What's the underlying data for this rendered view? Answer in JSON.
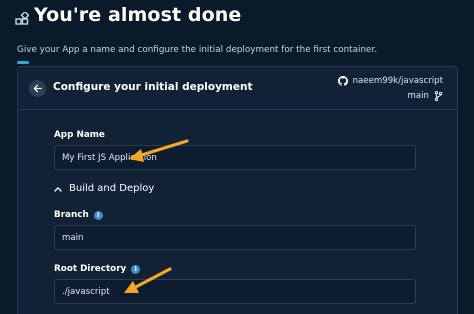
{
  "header": {
    "title": "You're almost done",
    "subtitle": "Give your App a name and configure the initial deployment for the first container.",
    "icon": "apps-grid-icon"
  },
  "card": {
    "title": "Configure your initial deployment",
    "repo": "naeem99k/javascript",
    "branch": "main"
  },
  "form": {
    "app_name": {
      "label": "App Name",
      "value": "My First JS Application"
    },
    "build_section": {
      "label": "Build and Deploy",
      "expanded": true
    },
    "branch": {
      "label": "Branch",
      "value": "main"
    },
    "root_directory": {
      "label": "Root Directory",
      "value": "./javascript"
    }
  },
  "colors": {
    "background": "#0b1a2b",
    "card": "#112236",
    "accent": "#34a6d4",
    "annotation_arrow": "#f5a623",
    "info": "#3a8fd1"
  }
}
